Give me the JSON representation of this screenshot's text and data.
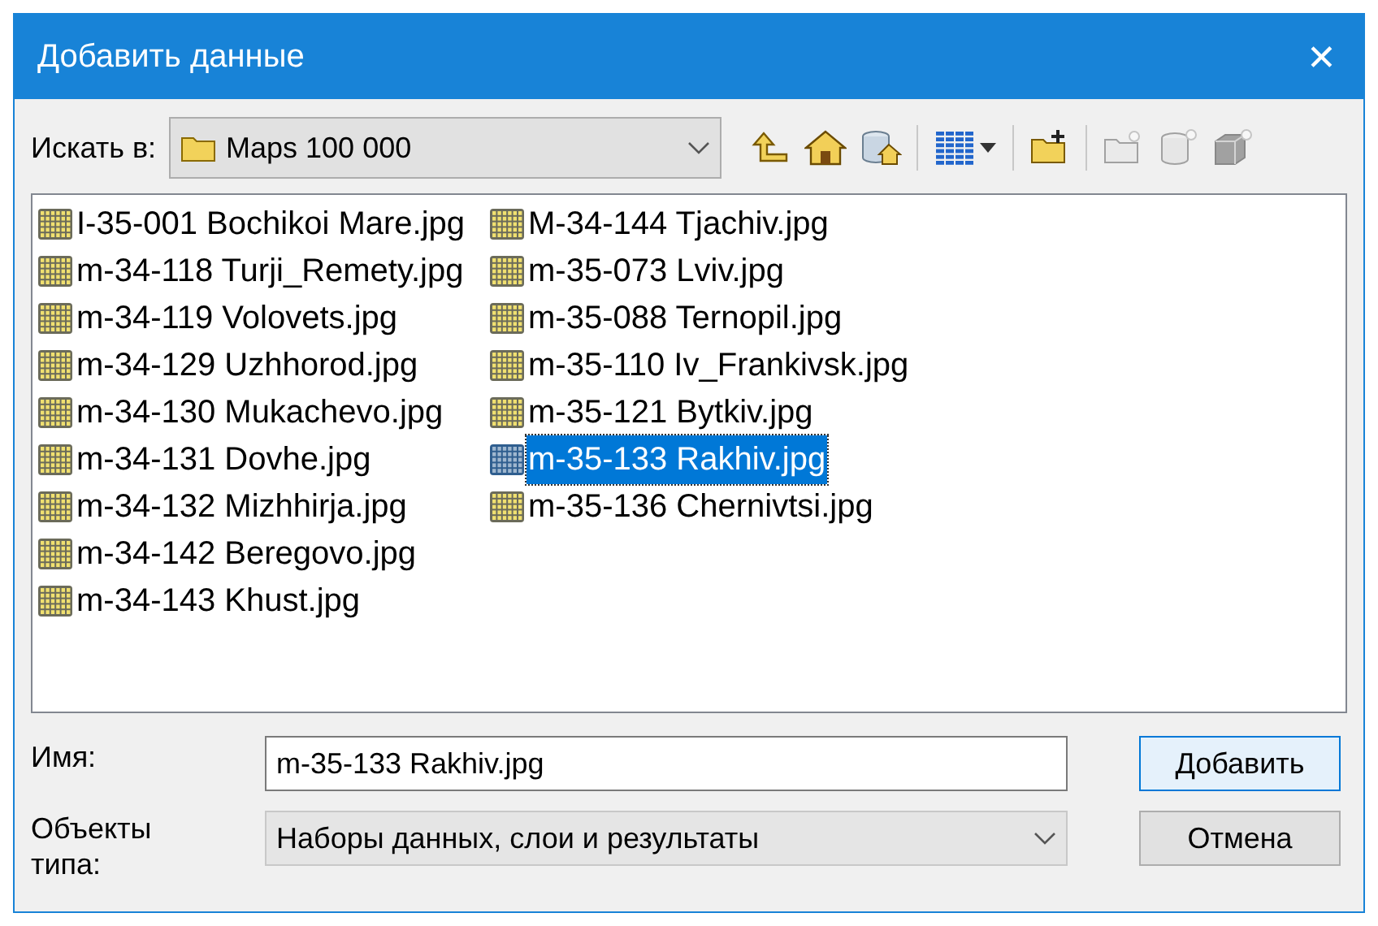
{
  "window": {
    "title": "Добавить данные",
    "close": "✕"
  },
  "look_in": {
    "label": "Искать в:",
    "value": "Maps 100 000"
  },
  "toolbar": [
    {
      "kind": "up",
      "disabled": false
    },
    {
      "kind": "home",
      "disabled": false
    },
    {
      "kind": "dbhome",
      "disabled": false
    },
    {
      "kind": "sep"
    },
    {
      "kind": "view",
      "disabled": false
    },
    {
      "kind": "sep"
    },
    {
      "kind": "newfolder",
      "disabled": false
    },
    {
      "kind": "sep"
    },
    {
      "kind": "newfile",
      "disabled": true
    },
    {
      "kind": "newdb",
      "disabled": true
    },
    {
      "kind": "newtoolbox",
      "disabled": true
    }
  ],
  "files": [
    {
      "name": "I-35-001 Bochikoi Mare.jpg",
      "selected": false
    },
    {
      "name": "m-34-118 Turji_Remety.jpg",
      "selected": false
    },
    {
      "name": "m-34-119 Volovets.jpg",
      "selected": false
    },
    {
      "name": "m-34-129 Uzhhorod.jpg",
      "selected": false
    },
    {
      "name": "m-34-130 Mukachevo.jpg",
      "selected": false
    },
    {
      "name": "m-34-131 Dovhe.jpg",
      "selected": false
    },
    {
      "name": "m-34-132 Mizhhirja.jpg",
      "selected": false
    },
    {
      "name": "m-34-142 Beregovo.jpg",
      "selected": false
    },
    {
      "name": "m-34-143 Khust.jpg",
      "selected": false
    },
    {
      "name": "M-34-144 Tjachiv.jpg",
      "selected": false
    },
    {
      "name": "m-35-073 Lviv.jpg",
      "selected": false
    },
    {
      "name": "m-35-088 Ternopil.jpg",
      "selected": false
    },
    {
      "name": "m-35-110 Iv_Frankivsk.jpg",
      "selected": false
    },
    {
      "name": "m-35-121 Bytkiv.jpg",
      "selected": false
    },
    {
      "name": "m-35-133 Rakhiv.jpg",
      "selected": true
    },
    {
      "name": "m-35-136 Chernivtsi.jpg",
      "selected": false
    }
  ],
  "name_field": {
    "label": "Имя:",
    "value": "m-35-133 Rakhiv.jpg"
  },
  "type_field": {
    "label": "Объекты типа:",
    "value": "Наборы данных, слои и результаты"
  },
  "buttons": [
    {
      "label": "Добавить",
      "default": true
    },
    {
      "label": "Отмена",
      "default": false
    }
  ]
}
